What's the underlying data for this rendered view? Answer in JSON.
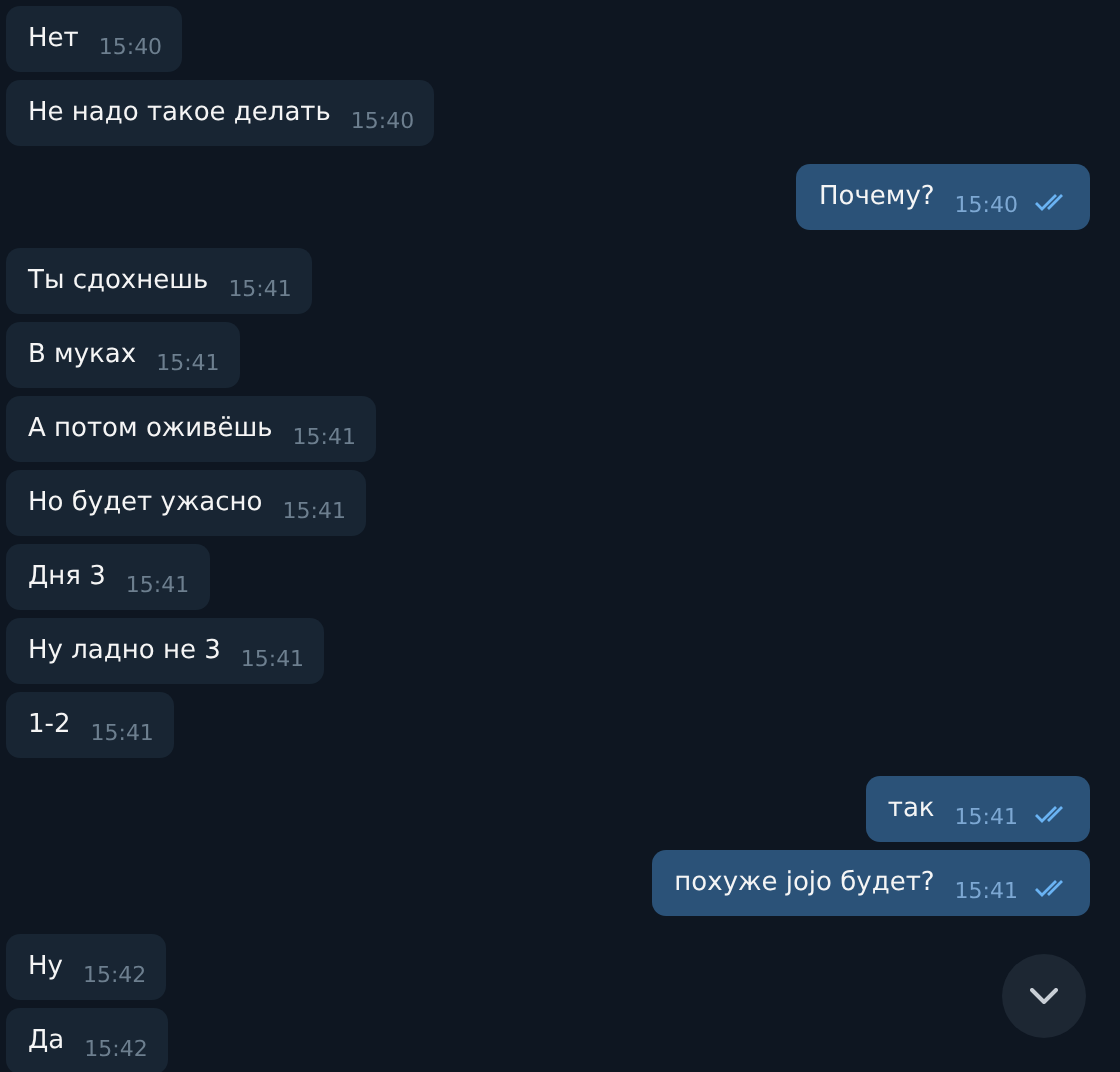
{
  "groups": [
    {
      "kind": "in",
      "messages": [
        {
          "text": "Нет",
          "time": "15:40"
        },
        {
          "text": "Не надо такое делать",
          "time": "15:40"
        }
      ]
    },
    {
      "kind": "out",
      "messages": [
        {
          "text": "Почему?",
          "time": "15:40",
          "read": true
        }
      ]
    },
    {
      "kind": "in",
      "messages": [
        {
          "text": "Ты сдохнешь",
          "time": "15:41"
        },
        {
          "text": "В муках",
          "time": "15:41"
        },
        {
          "text": "А потом оживёшь",
          "time": "15:41"
        },
        {
          "text": "Но будет ужасно",
          "time": "15:41"
        },
        {
          "text": "Дня 3",
          "time": "15:41"
        },
        {
          "text": "Ну ладно не 3",
          "time": "15:41"
        },
        {
          "text": "1-2",
          "time": "15:41"
        }
      ]
    },
    {
      "kind": "out",
      "messages": [
        {
          "text": "так",
          "time": "15:41",
          "read": true
        },
        {
          "text": "похуже jojo будет?",
          "time": "15:41",
          "read": true
        }
      ]
    },
    {
      "kind": "in",
      "messages": [
        {
          "text": "Ну",
          "time": "15:42"
        },
        {
          "text": "Да",
          "time": "15:42"
        }
      ]
    }
  ]
}
